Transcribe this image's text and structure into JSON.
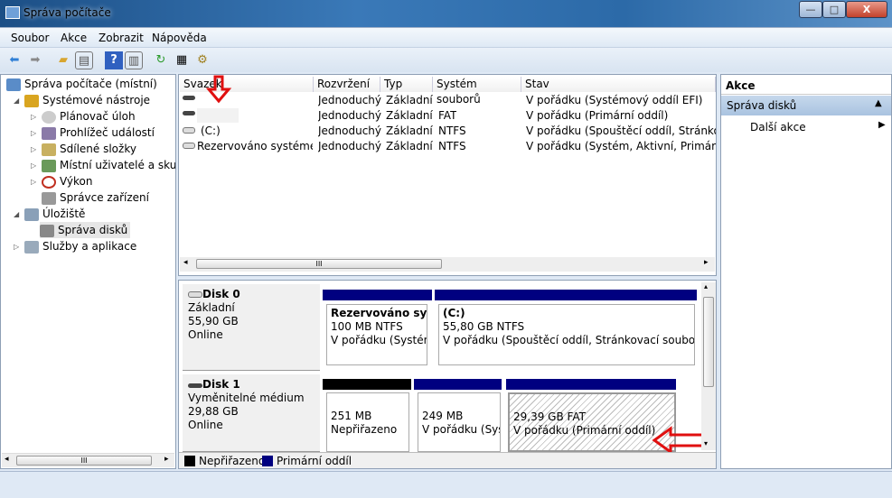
{
  "window": {
    "title": "Správa počítače",
    "minimize": "—",
    "maximize": "□",
    "close": "X"
  },
  "menu": [
    "Soubor",
    "Akce",
    "Zobrazit",
    "Nápověda"
  ],
  "toolbar": [
    "back-icon",
    "forward-icon",
    "up-folder-icon",
    "show-tree-icon",
    "help-icon",
    "show-action-icon",
    "refresh-icon",
    "properties-icon",
    "settings-icon"
  ],
  "tree": {
    "root": "Správa počítače (místní)",
    "items": [
      {
        "label": "Systémové nástroje",
        "level": 1
      },
      {
        "label": "Plánovač úloh",
        "level": 2
      },
      {
        "label": "Prohlížeč událostí",
        "level": 2
      },
      {
        "label": "Sdílené složky",
        "level": 2
      },
      {
        "label": "Místní uživatelé a skupiny",
        "level": 2
      },
      {
        "label": "Výkon",
        "level": 2
      },
      {
        "label": "Správce zařízení",
        "level": 2
      },
      {
        "label": "Úložiště",
        "level": 1
      },
      {
        "label": "Správa disků",
        "level": 2
      },
      {
        "label": "Služby a aplikace",
        "level": 1
      }
    ]
  },
  "volumes": {
    "headers": [
      "Svazek",
      "Rozvržení",
      "Typ",
      "Systém souborů",
      "Stav"
    ],
    "rows": [
      [
        "",
        "Jednoduchý",
        "Základní",
        "",
        "V pořádku (Systémový oddíl EFI)"
      ],
      [
        "",
        "Jednoduchý",
        "Základní",
        "FAT",
        "V pořádku (Primární oddíl)"
      ],
      [
        "(C:)",
        "Jednoduchý",
        "Základní",
        "NTFS",
        "V pořádku (Spouštěcí oddíl, Stránkovací soubor, Stav"
      ],
      [
        "Rezervováno systémem",
        "Jednoduchý",
        "Základní",
        "NTFS",
        "V pořádku (Systém, Aktivní, Primární oddíl)"
      ]
    ],
    "scroll_grip": "III"
  },
  "disks": [
    {
      "name": "Disk 0",
      "type": "Základní",
      "size": "55,90 GB",
      "status": "Online",
      "partitions": [
        {
          "title": "Rezervováno systémem",
          "size": "100 MB NTFS",
          "status": "V pořádku (Systém, Aktivní, Primární oddíl)"
        },
        {
          "title": "(C:)",
          "size": "55,80 GB NTFS",
          "status": "V pořádku (Spouštěcí oddíl, Stránkovací soubor, Stav"
        }
      ]
    },
    {
      "name": "Disk 1",
      "type": "Vyměnitelné médium",
      "size": "29,88 GB",
      "status": "Online",
      "partitions": [
        {
          "size": "251 MB",
          "status": "Nepřiřazeno"
        },
        {
          "size": "249 MB",
          "status": "V pořádku (Systémový oddíl EFI)"
        },
        {
          "size": "29,39 GB FAT",
          "status": "V pořádku (Primární oddíl)"
        }
      ]
    }
  ],
  "legend": [
    {
      "label": "Nepřiřazeno",
      "color": "#000000"
    },
    {
      "label": "Primární oddíl",
      "color": "#000080"
    }
  ],
  "actions": {
    "header": "Akce",
    "section": "Správa disků",
    "item": "Další akce"
  },
  "tree_scroll_grip": "III"
}
